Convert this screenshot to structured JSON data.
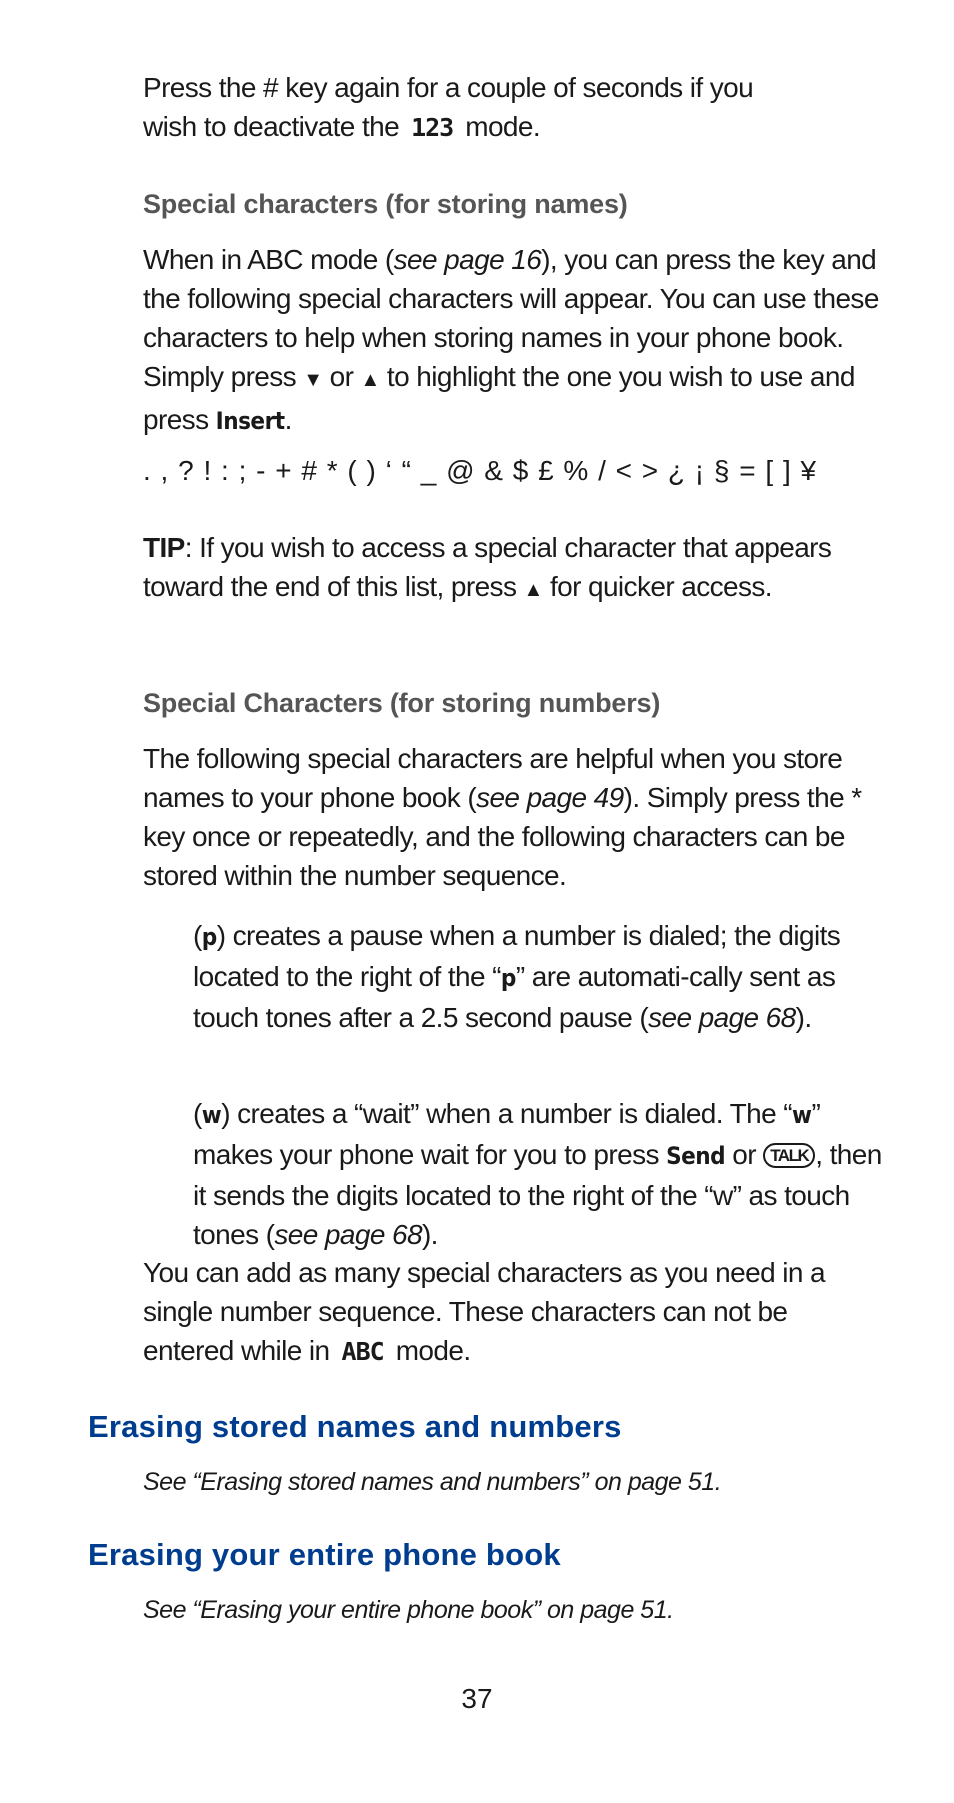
{
  "intro": {
    "line1": "Press the # key again for a couple of seconds if you",
    "line2_pre": "wish to deactivate the",
    "mode_icon": "123",
    "line2_post": "mode."
  },
  "names_section": {
    "heading": "Special characters (for storing names)",
    "p1_a": "When in ABC mode (",
    "p1_ref": "see page 16",
    "p1_b": "), you can press the key and the following special characters will appear. You can use these characters to help when storing names in your phone book. Simply press",
    "down_arrow": "▼",
    "or": "or",
    "up_arrow": "▲",
    "p1_c": "to highlight the one you wish to use and press",
    "insert_key": "Insert",
    "p1_end": ".",
    "characters": ". , ? ! : ; - + # * ( ) ‘ “ _ @ & $ £ % / < > ¿ ¡ § = [ ] ¥",
    "tip_label": "TIP",
    "tip_a": ": If you wish to access a special character that appears toward the end of this list, press",
    "tip_arrow": "▲",
    "tip_b": "for quicker access."
  },
  "numbers_section": {
    "heading": "Special Characters (for storing numbers)",
    "p1_a": "The following special characters are helpful when you store names to your phone book (",
    "p1_ref": "see page 49",
    "p1_b": "). Simply press the * key once or repeatedly, and the following characters can be stored within the number sequence.",
    "pause": {
      "open": "(",
      "char": "p",
      "text_a": ") creates a pause when a number is dialed; the digits located to the right of the “",
      "char2": "p",
      "text_b": "” are automati-cally sent as touch tones after a 2.5 second pause (",
      "ref": "see page 68",
      "text_c": ")."
    },
    "wait": {
      "open": "(",
      "char": "w",
      "text_a": ") creates a “wait” when a number is dialed. The “",
      "char2": "w",
      "text_b": "” makes your phone wait for you to press",
      "send_key": "Send",
      "or": "or",
      "talk_key": "TALK",
      "text_c": ", then it sends the digits located to the right of the “w” as touch tones (",
      "ref": "see page 68",
      "text_d": ")."
    },
    "closing_a": "You can add as many special characters as you need in a single number sequence. These characters can not be entered while in",
    "mode_icon": "ABC",
    "closing_b": "mode."
  },
  "erase_names": {
    "heading": "Erasing stored names and numbers",
    "xref": "See “Erasing stored names and numbers” on page 51."
  },
  "erase_book": {
    "heading": "Erasing your entire phone book",
    "xref": "See “Erasing your entire phone book” on page 51."
  },
  "page_number": "37",
  "colors": {
    "section_heading": "#003d8f",
    "sub_heading": "#555555",
    "body_text": "#1a1a1a"
  }
}
